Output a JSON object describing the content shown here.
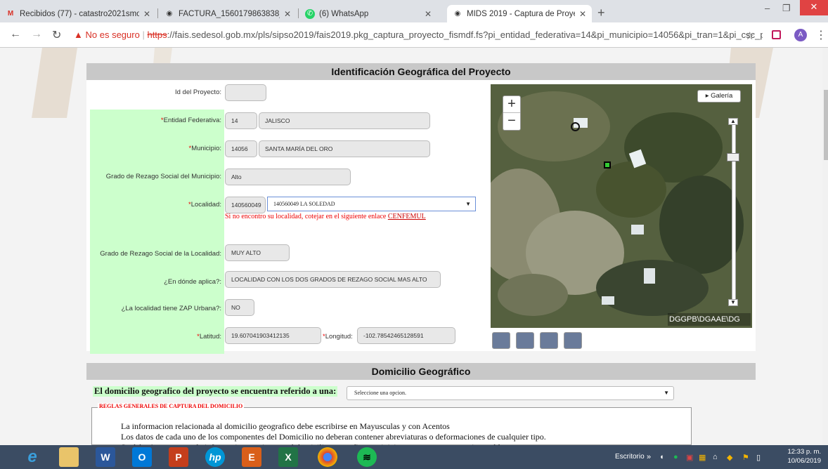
{
  "browser": {
    "tabs": [
      {
        "label": "Recibidos (77) - catastro2021smo",
        "icon": "gmail-icon"
      },
      {
        "label": "FACTURA_1560179863838_23980",
        "icon": "globe-icon"
      },
      {
        "label": "(6) WhatsApp",
        "icon": "whatsapp-icon"
      },
      {
        "label": "MIDS 2019 - Captura de Proyectos",
        "icon": "globe-icon",
        "active": true
      }
    ],
    "address": {
      "insecure_label": "No es seguro",
      "protocol": "https",
      "url_rest": "://fais.sedesol.gob.mx/pls/sipso2019/fais2019.pkg_captura_proyecto_fismdf.fs?pi_entidad_federativa=14&pi_municipio=14056&pi_tran=1&pi_csc_pr..."
    },
    "profile_initial": "A"
  },
  "geo": {
    "title": "Identificación Geográfica del Proyecto",
    "fields": {
      "id_label": "Id del Proyecto:",
      "id_value": "",
      "entidad_label": "Entidad Federativa:",
      "entidad_code": "14",
      "entidad_name": "JALISCO",
      "municipio_label": "Municipio:",
      "municipio_code": "14056",
      "municipio_name": "SANTA MARÍA DEL ORO",
      "rezago_mun_label": "Grado de Rezago Social del Municipio:",
      "rezago_mun_value": "Alto",
      "localidad_label": "Localidad:",
      "localidad_code": "140560049",
      "localidad_select": "140560049 LA SOLEDAD",
      "localidad_note": "Si no encontro su localidad, cotejar en el siguiente enlace",
      "localidad_link": "CENFEMUL",
      "rezago_loc_label": "Grado de Rezago Social de la Localidad:",
      "rezago_loc_value": "MUY ALTO",
      "aplica_label": "¿En dónde aplica?:",
      "aplica_value": "LOCALIDAD CON LOS DOS GRADOS DE REZAGO SOCIAL MAS ALTO",
      "zap_label": "¿La localidad tiene ZAP Urbana?:",
      "zap_value": "NO",
      "latitud_label": "Latitud:",
      "latitud_value": "19.607041903412135",
      "longitud_label": "Longitud:",
      "longitud_value": "-102.78542465128591"
    },
    "map": {
      "zoom_in": "+",
      "zoom_out": "−",
      "galeria": "▸ Galería",
      "attribution": "DGGPB\\DGAAE\\DG"
    }
  },
  "domicilio": {
    "title": "Domicilio Geográfico",
    "question": "El domicilio geografico del proyecto se encuentra referido a una:",
    "select_value": "Seleccione una opcion.",
    "rules_title": "REGLAS GENERALES DE CAPTURA DEL DOMICILIO",
    "rules": [
      "La informacion relacionada al domicilio geografico debe escribirse en Mayusculas y con Acentos",
      "Los datos de cada uno de los componentes del Domicilio no deberan contener abreviaturas o deformaciones de cualquier tipo.",
      "Se debe Asegurar que la informacion que integra el domicilio geografico, no inicie con uno o mas espacios en blanco."
    ]
  },
  "taskbar": {
    "escritorio": "Escritorio",
    "time": "12:33 p. m.",
    "date": "10/06/2019"
  }
}
